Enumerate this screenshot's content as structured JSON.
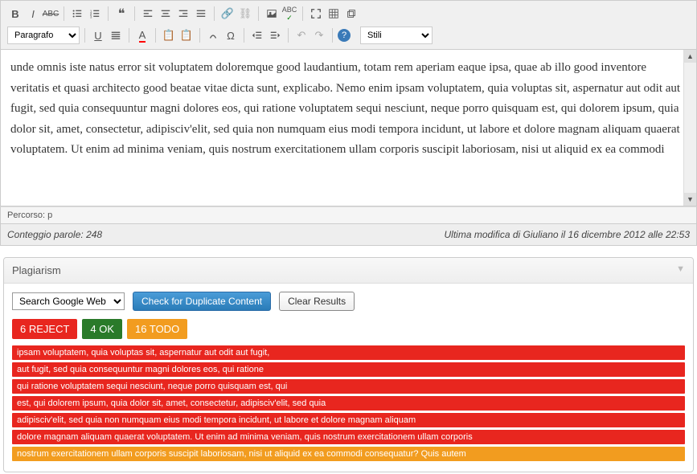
{
  "editor": {
    "format_select": "Paragrafo",
    "style_select": "Stili",
    "content": "unde omnis iste natus error sit voluptatem doloremque good laudantium, totam rem aperiam eaque ipsa, quae ab illo good inventore veritatis et quasi architecto good beatae vitae dicta sunt, explicabo. Nemo enim ipsam voluptatem, quia voluptas sit, aspernatur aut odit aut fugit, sed quia consequuntur magni dolores eos, qui ratione voluptatem sequi nesciunt, neque porro quisquam est, qui dolorem ipsum, quia dolor sit, amet, consectetur, adipisciv'elit, sed quia non numquam eius modi tempora incidunt, ut labore et dolore magnam aliquam quaerat voluptatem. Ut enim ad minima veniam, quis nostrum exercitationem ullam corporis suscipit laboriosam, nisi ut aliquid ex ea commodi",
    "path": "Percorso: p",
    "word_count": "Conteggio parole: 248",
    "last_modified": "Ultima modifica di Giuliano il 16 dicembre 2012 alle 22:53"
  },
  "plagiarism": {
    "title": "Plagiarism",
    "search_select": "Search Google Web",
    "check_btn": "Check for Duplicate Content",
    "clear_btn": "Clear Results",
    "badges": {
      "reject": "6 REJECT",
      "ok": "4 OK",
      "todo": "16 TODO"
    },
    "results": [
      {
        "text": "ipsam voluptatem, quia voluptas sit, aspernatur aut odit aut fugit,",
        "kind": "red"
      },
      {
        "text": "aut fugit, sed quia consequuntur magni dolores eos, qui ratione",
        "kind": "red"
      },
      {
        "text": "qui ratione voluptatem sequi nesciunt, neque porro quisquam est, qui",
        "kind": "red"
      },
      {
        "text": "est, qui dolorem ipsum, quia dolor sit, amet, consectetur, adipisciv'elit, sed quia",
        "kind": "red"
      },
      {
        "text": "adipisciv'elit, sed quia non numquam eius modi tempora incidunt, ut labore et dolore magnam aliquam",
        "kind": "red"
      },
      {
        "text": "dolore magnam aliquam quaerat voluptatem. Ut enim ad minima veniam, quis nostrum exercitationem ullam corporis",
        "kind": "red"
      },
      {
        "text": "nostrum exercitationem ullam corporis suscipit laboriosam, nisi ut aliquid ex ea commodi consequatur? Quis autem",
        "kind": "orange"
      }
    ]
  }
}
